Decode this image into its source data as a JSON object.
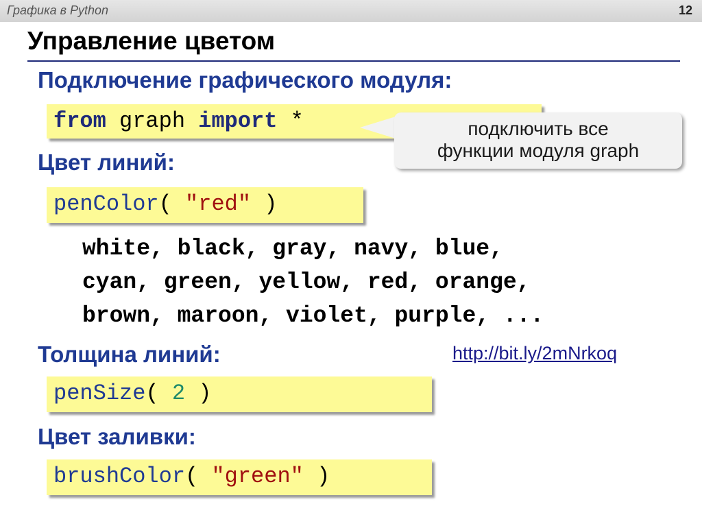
{
  "header": {
    "course": "Графика в Python",
    "slide_number": "12"
  },
  "title": "Управление цветом",
  "sections": {
    "module": {
      "heading": "Подключение графического модуля:"
    },
    "line_color": {
      "heading": "Цвет линий:"
    },
    "line_width": {
      "heading": "Толщина линий:"
    },
    "fill_color": {
      "heading": "Цвет заливки:"
    }
  },
  "code": {
    "import": {
      "kw1": "from",
      "mod": " graph ",
      "kw2": "import",
      "star": " *"
    },
    "pen_color": {
      "fn": "penColor",
      "open": "( ",
      "arg": "\"red\"",
      "close": " )"
    },
    "pen_size": {
      "fn": "penSize",
      "open": "( ",
      "arg": "2",
      "close": " )"
    },
    "brush_color": {
      "fn": "brushColor",
      "open": "( ",
      "arg": "\"green\"",
      "close": " )"
    }
  },
  "callout": {
    "line1": "подключить все",
    "line2": "функции модуля graph"
  },
  "color_names": [
    "white, black, gray, navy, blue,",
    "cyan, green, yellow, red, orange,",
    "brown, maroon, violet, purple, ..."
  ],
  "link": "http://bit.ly/2mNrkoq"
}
